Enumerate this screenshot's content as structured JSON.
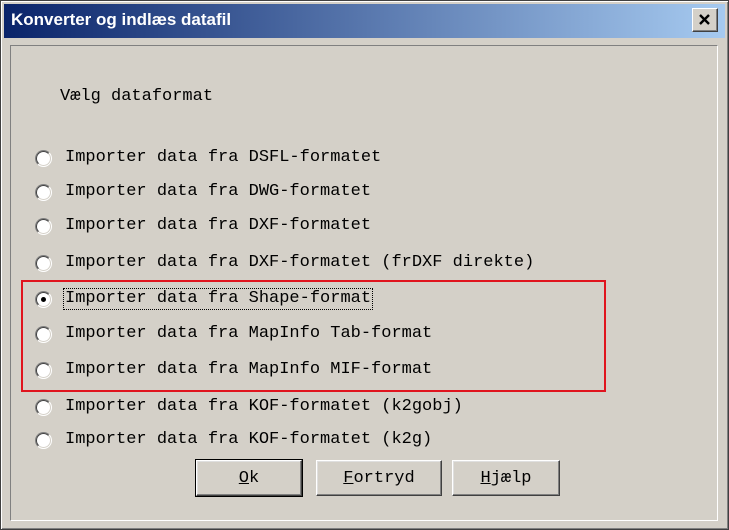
{
  "window": {
    "title": "Konverter og indlæs datafil"
  },
  "heading": "Vælg dataformat",
  "options": [
    {
      "label": "Importer data fra DSFL-formatet",
      "selected": false
    },
    {
      "label": "Importer data fra DWG-formatet",
      "selected": false
    },
    {
      "label": "Importer data fra DXF-formatet",
      "selected": false
    },
    {
      "label": "Importer data fra DXF-formatet (frDXF direkte)",
      "selected": false
    },
    {
      "label": "Importer data fra Shape-format",
      "selected": true
    },
    {
      "label": "Importer data fra MapInfo Tab-format",
      "selected": false
    },
    {
      "label": "Importer data fra MapInfo MIF-format",
      "selected": false
    },
    {
      "label": "Importer data fra KOF-formatet (k2gobj)",
      "selected": false
    },
    {
      "label": "Importer data fra KOF-formatet (k2g)",
      "selected": false
    }
  ],
  "selected_option": "Importer data fra Shape-format",
  "highlight_color": "#e0141e",
  "buttons": {
    "ok": {
      "accel": "O",
      "rest": "k"
    },
    "cancel": {
      "accel": "F",
      "rest": "ortryd"
    },
    "help": {
      "accel": "H",
      "rest": "jælp"
    }
  },
  "icons": {
    "close": "close-icon"
  }
}
